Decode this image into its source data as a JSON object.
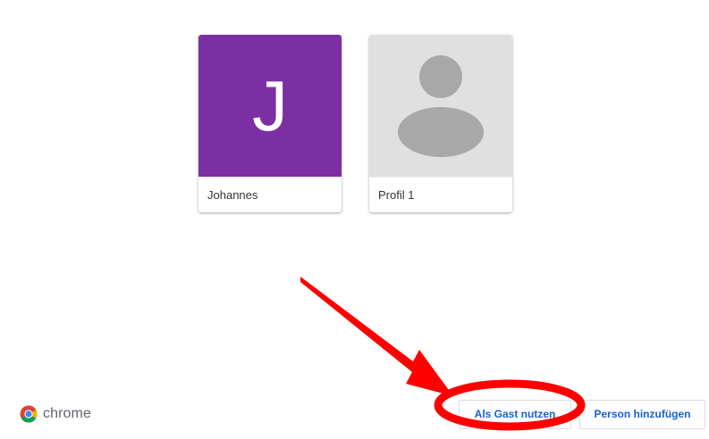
{
  "profiles": [
    {
      "name": "Johannes",
      "initial": "J",
      "avatar_color": "#7b2fa3",
      "avatar_type": "letter"
    },
    {
      "name": "Profil 1",
      "avatar_color": "#e0e0e0",
      "avatar_type": "default-person-icon"
    }
  ],
  "footer": {
    "brand": "chrome",
    "brand_icon": "chrome-logo-icon",
    "guest_button": "Als Gast nutzen",
    "add_person_button": "Person hinzufügen"
  },
  "annotation": {
    "arrow_color": "#ff0000",
    "circle_color": "#ff0000"
  },
  "colors": {
    "button_text": "#1a5fd1",
    "default_avatar_icon": "#a8a8a8"
  }
}
